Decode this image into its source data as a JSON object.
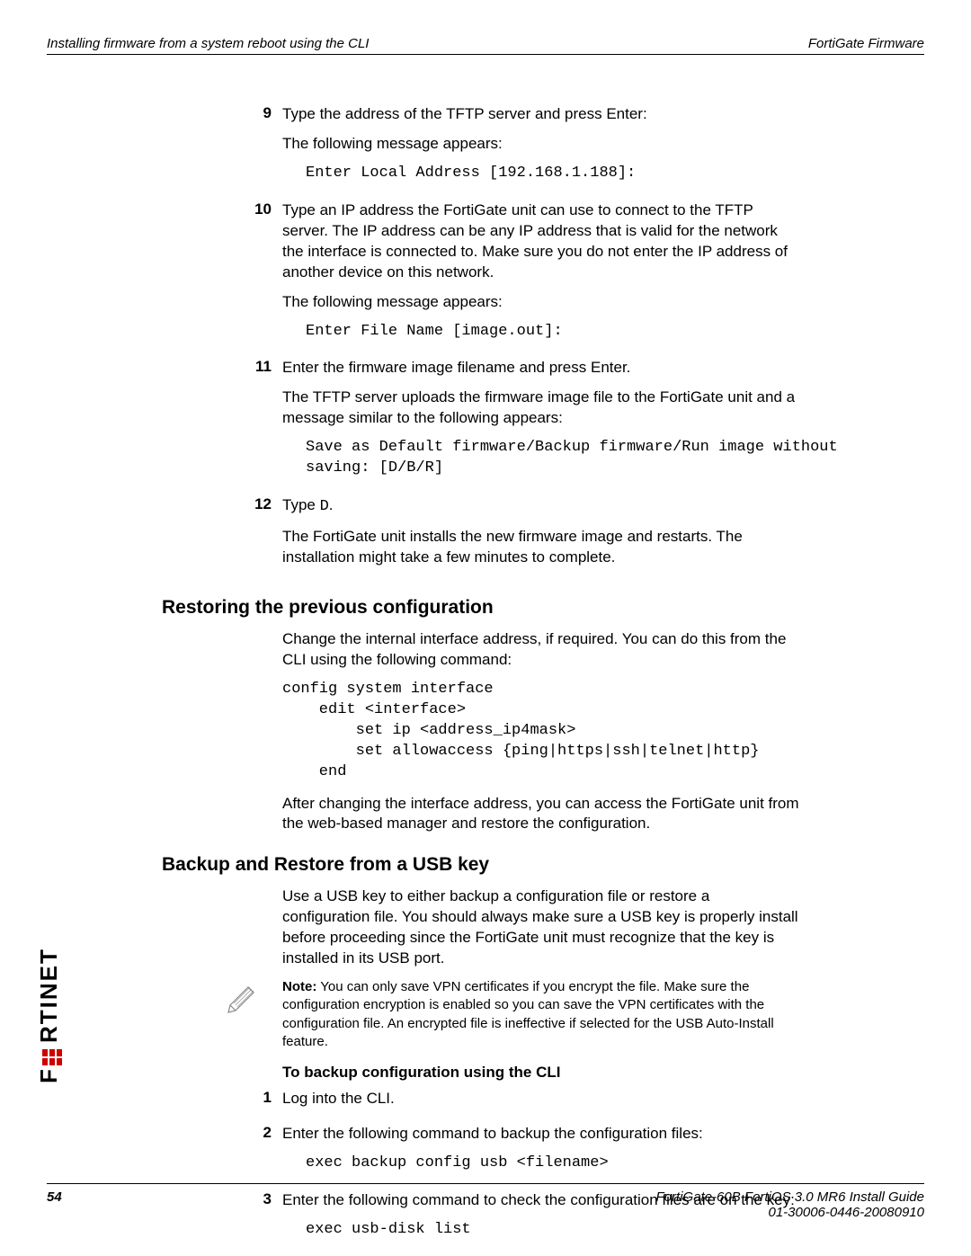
{
  "header": {
    "left": "Installing firmware from a system reboot using the CLI",
    "right": "FortiGate Firmware"
  },
  "steps": {
    "s9": {
      "num": "9",
      "p1": "Type the address of the TFTP server and press Enter:",
      "p2": "The following message appears:",
      "code": "Enter Local Address [192.168.1.188]:"
    },
    "s10": {
      "num": "10",
      "p1": "Type an IP address the FortiGate unit can use to connect to the TFTP server. The IP address can be any IP address that is valid for the network the interface is connected to. Make sure you do not enter the IP address of another device on this network.",
      "p2": "The following message appears:",
      "code": "Enter File Name [image.out]:"
    },
    "s11": {
      "num": "11",
      "p1": "Enter the firmware image filename and press Enter.",
      "p2": "The TFTP server uploads the firmware image file to the FortiGate unit and a message similar to the following appears:",
      "code": "Save as Default firmware/Backup firmware/Run image without\nsaving: [D/B/R]"
    },
    "s12": {
      "num": "12",
      "p1a": "Type ",
      "p1code": "D",
      "p1b": ".",
      "p2": "The FortiGate unit installs the new firmware image and restarts. The installation might take a few minutes to complete."
    }
  },
  "restoring": {
    "heading": "Restoring the previous configuration",
    "p1": "Change the internal interface address, if required. You can do this from the CLI using the following command:",
    "code": "config system interface\n    edit <interface>\n        set ip <address_ip4mask>\n        set allowaccess {ping|https|ssh|telnet|http}\n    end",
    "p2": "After changing the interface address, you can access the FortiGate unit from the web-based manager and restore the configuration."
  },
  "usb": {
    "heading": "Backup and Restore from a USB key",
    "p1": "Use a USB key to either backup a configuration file or restore a configuration file. You should always make sure a USB key is properly install before proceeding since the FortiGate unit must recognize that the key is installed in its USB port.",
    "note_label": "Note:",
    "note_text": " You can only save VPN certificates if you encrypt the file. Make sure the configuration encryption is enabled so you can save the VPN certificates with the configuration file. An encrypted file is ineffective if selected for the USB Auto-Install feature.",
    "sub_heading": "To backup configuration using the CLI",
    "s1": {
      "num": "1",
      "p": "Log into the CLI."
    },
    "s2": {
      "num": "2",
      "p": "Enter the following command to backup the configuration files:",
      "code": "exec backup config usb <filename>"
    },
    "s3": {
      "num": "3",
      "p": "Enter the following command to check the configuration files are on the key:",
      "code": "exec usb-disk list"
    }
  },
  "footer": {
    "page": "54",
    "title": "FortiGate-60B FortiOS 3.0 MR6 Install Guide",
    "docid": "01-30006-0446-20080910"
  }
}
